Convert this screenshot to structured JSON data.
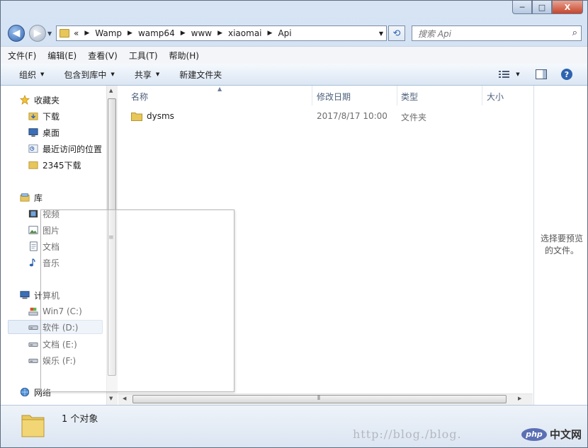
{
  "window": {
    "controls": {
      "minimize": "─",
      "maximize": "□",
      "close": "X"
    }
  },
  "address": {
    "overflow": "«",
    "crumbs": [
      "Wamp",
      "wamp64",
      "www",
      "xiaomai",
      "Api"
    ],
    "search_placeholder": "搜索 Api"
  },
  "menu": [
    "文件(F)",
    "编辑(E)",
    "查看(V)",
    "工具(T)",
    "帮助(H)"
  ],
  "toolbar": {
    "organize": "组织",
    "include_library": "包含到库中",
    "share": "共享",
    "new_folder": "新建文件夹"
  },
  "sidebar": {
    "favorites": {
      "label": "收藏夹",
      "items": [
        "下载",
        "桌面",
        "最近访问的位置",
        "2345下载"
      ]
    },
    "libraries": {
      "label": "库",
      "items": [
        "视频",
        "图片",
        "文档",
        "音乐"
      ]
    },
    "computer": {
      "label": "计算机",
      "items": [
        "Win7 (C:)",
        "软件 (D:)",
        "文档 (E:)",
        "娱乐 (F:)"
      ]
    },
    "network": {
      "label": "网络"
    }
  },
  "columns": {
    "name": "名称",
    "date": "修改日期",
    "type": "类型",
    "size": "大小"
  },
  "files": [
    {
      "name": "dysms",
      "date": "2017/8/17 10:00",
      "type": "文件夹",
      "size": ""
    }
  ],
  "preview": {
    "text": "选择要预览的文件。"
  },
  "status": {
    "count": "1 个对象"
  },
  "watermark": {
    "url": "http://blog./blog.",
    "brand_php": "php",
    "brand_cn": "中文网"
  },
  "colors": {
    "folder": "#e7c65a",
    "accent": "#2f63b0",
    "selection": "#e6eef8"
  }
}
